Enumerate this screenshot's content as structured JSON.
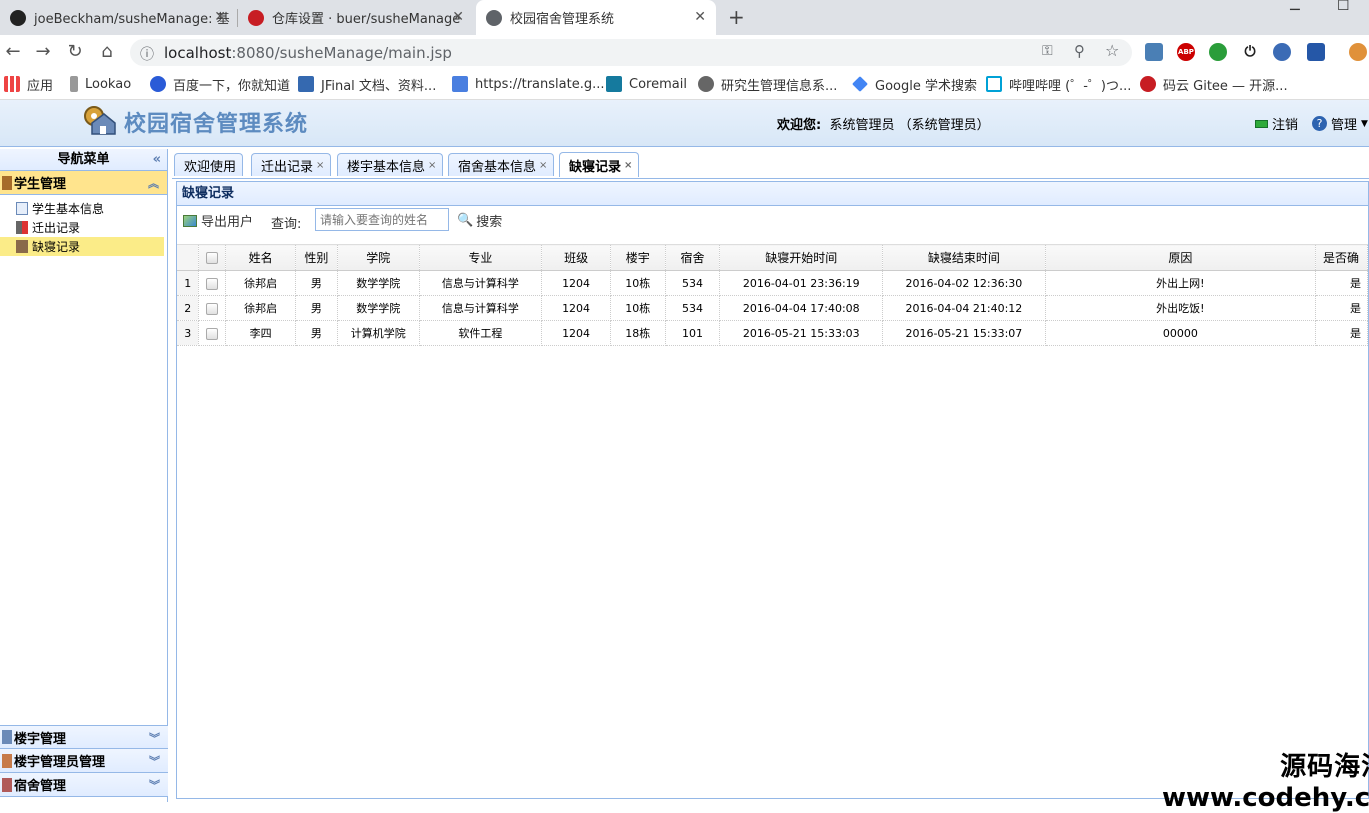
{
  "browser": {
    "tabs": [
      {
        "title": "joeBeckham/susheManage: 基",
        "icon": "github-icon"
      },
      {
        "title": "仓库设置 · buer/susheManage",
        "icon": "gitee-icon"
      },
      {
        "title": "校园宿舍管理系统",
        "icon": "globe-icon"
      }
    ],
    "new_tab": "+",
    "url_host": "localhost",
    "url_rest": ":8080/susheManage/main.jsp",
    "bookmarks": [
      "应用",
      "Lookao",
      "百度一下，你就知道",
      "JFinal 文档、资料...",
      "https://translate.g...",
      "Coremail",
      "研究生管理信息系...",
      "Google 学术搜索",
      "哔哩哔哩 (゜-゜)つ...",
      "码云 Gitee — 开源..."
    ]
  },
  "header": {
    "title": "校园宿舍管理系统",
    "welcome_label": "欢迎您:",
    "welcome_user": "系统管理员 （系统管理员）",
    "logout": "注销",
    "manage": "管理"
  },
  "sidebar": {
    "title": "导航菜单",
    "collapse": "«",
    "groups": [
      {
        "label": "学生管理",
        "items": [
          "学生基本信息",
          "迁出记录",
          "缺寝记录"
        ]
      },
      {
        "label": "楼宇管理"
      },
      {
        "label": "楼宇管理员管理"
      },
      {
        "label": "宿舍管理"
      }
    ]
  },
  "tabs": [
    {
      "label": "欢迎使用"
    },
    {
      "label": "迁出记录"
    },
    {
      "label": "楼宇基本信息"
    },
    {
      "label": "宿舍基本信息"
    },
    {
      "label": "缺寝记录"
    }
  ],
  "panel": {
    "title": "缺寝记录",
    "export": "导出用户",
    "query_label": "查询:",
    "search_placeholder": "请输入要查询的姓名",
    "search_button": "搜索"
  },
  "table": {
    "headers": [
      "姓名",
      "性别",
      "学院",
      "专业",
      "班级",
      "楼宇",
      "宿舍",
      "缺寝开始时间",
      "缺寝结束时间",
      "原因",
      "是否确"
    ],
    "rows": [
      [
        "1",
        "徐邦启",
        "男",
        "数学学院",
        "信息与计算科学",
        "1204",
        "10栋",
        "534",
        "2016-04-01 23:36:19",
        "2016-04-02 12:36:30",
        "外出上网!",
        "是"
      ],
      [
        "2",
        "徐邦启",
        "男",
        "数学学院",
        "信息与计算科学",
        "1204",
        "10栋",
        "534",
        "2016-04-04 17:40:08",
        "2016-04-04 21:40:12",
        "外出吃饭!",
        "是"
      ],
      [
        "3",
        "李四",
        "男",
        "计算机学院",
        "软件工程",
        "1204",
        "18栋",
        "101",
        "2016-05-21 15:33:03",
        "2016-05-21 15:33:07",
        "00000",
        "是"
      ]
    ]
  },
  "watermark": {
    "line1": "源码海洋网",
    "line2": "www.codehy.com"
  }
}
